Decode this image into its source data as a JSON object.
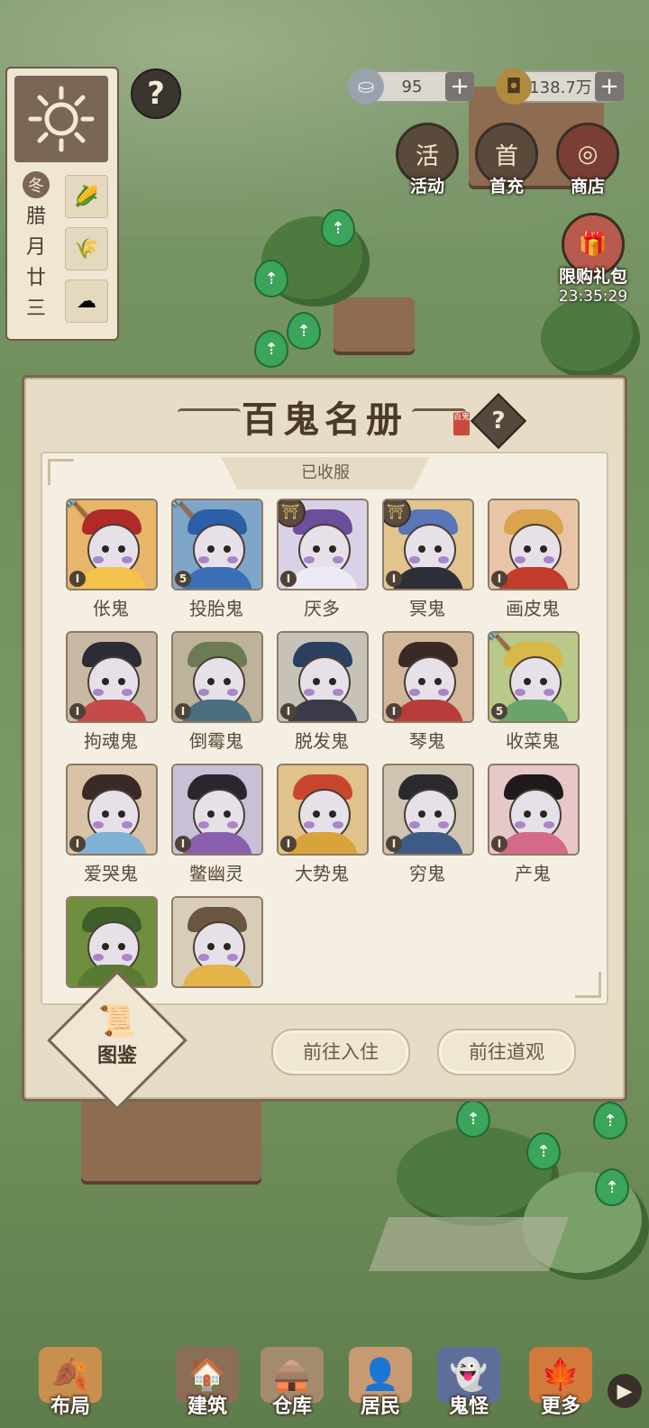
{
  "calendar": {
    "season": "冬",
    "date_line1": "腊",
    "date_line2": "月",
    "date_line3": "廿",
    "date_line4": "三"
  },
  "resources": {
    "silver": "95",
    "copper": "138.7万"
  },
  "top_buttons": {
    "activity": "活动",
    "first_charge": "首充",
    "shop": "商店",
    "limited_gift": "限购礼包",
    "gift_timer": "23:35:29"
  },
  "modal": {
    "title": "百鬼名册",
    "seal": "百鬼",
    "section_tab": "已收服",
    "tujian_label": "图鉴",
    "btn_residence": "前往入住",
    "btn_temple": "前往道观",
    "ghosts": [
      {
        "name": "伥鬼",
        "level": "I",
        "badge": "hammer"
      },
      {
        "name": "投胎鬼",
        "level": "5",
        "badge": "hammer"
      },
      {
        "name": "厌多",
        "level": "I",
        "badge": "temple"
      },
      {
        "name": "冥鬼",
        "level": "I",
        "badge": "temple"
      },
      {
        "name": "画皮鬼",
        "level": "I",
        "badge": ""
      },
      {
        "name": "拘魂鬼",
        "level": "I",
        "badge": ""
      },
      {
        "name": "倒霉鬼",
        "level": "I",
        "badge": ""
      },
      {
        "name": "脱发鬼",
        "level": "I",
        "badge": ""
      },
      {
        "name": "琴鬼",
        "level": "I",
        "badge": ""
      },
      {
        "name": "收菜鬼",
        "level": "5",
        "badge": "hammer"
      },
      {
        "name": "爱哭鬼",
        "level": "I",
        "badge": ""
      },
      {
        "name": "鳖幽灵",
        "level": "I",
        "badge": ""
      },
      {
        "name": "大势鬼",
        "level": "I",
        "badge": ""
      },
      {
        "name": "穷鬼",
        "level": "I",
        "badge": ""
      },
      {
        "name": "产鬼",
        "level": "I",
        "badge": ""
      },
      {
        "name": "",
        "level": "",
        "badge": ""
      },
      {
        "name": "",
        "level": "",
        "badge": ""
      }
    ]
  },
  "bottom_nav": {
    "layout": "布局",
    "build": "建筑",
    "storage": "仓库",
    "residents": "居民",
    "ghosts": "鬼怪",
    "more": "更多"
  }
}
